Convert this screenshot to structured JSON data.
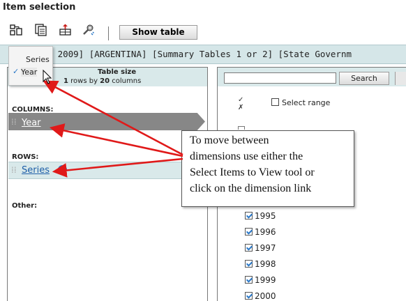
{
  "header": {
    "title": "Item selection"
  },
  "toolbar": {
    "icons": [
      "pivot-icon",
      "select-items-icon",
      "arrange-icon",
      "settings-icon"
    ],
    "show_table_label": "Show table"
  },
  "path": {
    "text": "ne 2009] [ARGENTINA] [Summary Tables 1 or 2] [State Governm"
  },
  "dropdown": {
    "items": [
      "Series",
      "Year"
    ],
    "checked": "Year"
  },
  "left_panel": {
    "table_size_title": "Table size",
    "table_size_rows": "1",
    "table_size_rows_suffix": " rows by ",
    "table_size_cols": "20",
    "table_size_cols_suffix": " columns",
    "columns_label": "COLUMNS:",
    "columns_item": "Year",
    "rows_label": "ROWS:",
    "rows_item": "Series",
    "other_label": "Other:"
  },
  "right_panel": {
    "search_placeholder": "",
    "search_label": "Search",
    "select_range_label": "Select range",
    "years": [
      "1995",
      "1996",
      "1997",
      "1998",
      "1999",
      "2000"
    ]
  },
  "callout": {
    "lines": [
      "To move between",
      "dimensions use either the",
      "Select Items to View tool or",
      "click on the dimension link"
    ]
  },
  "colors": {
    "panel_header": "#d9e9ea",
    "active_chip": "#878787",
    "arrow": "#e01919",
    "link": "#1f5fa8",
    "check": "#2a78c8"
  }
}
